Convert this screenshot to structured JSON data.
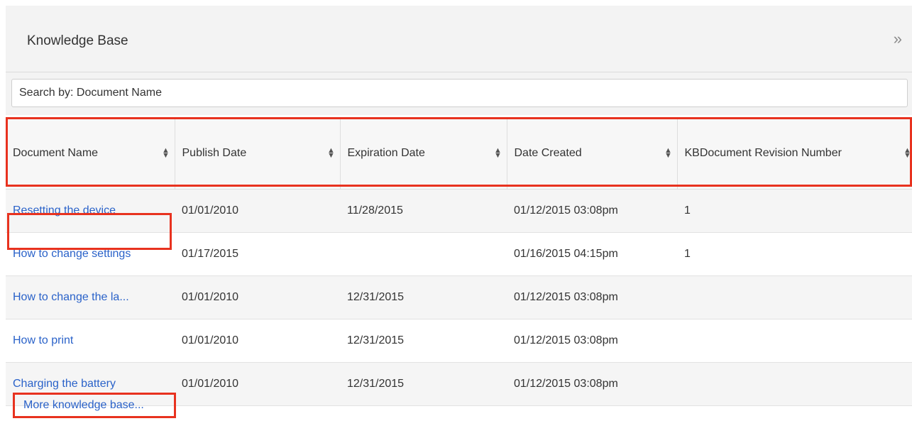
{
  "panel": {
    "title": "Knowledge Base",
    "collapse_icon": "»"
  },
  "search": {
    "placeholder": "Search by: Document Name"
  },
  "table": {
    "columns": [
      "Document Name",
      "Publish Date",
      "Expiration Date",
      "Date Created",
      "KBDocument Revision Number"
    ],
    "rows": [
      {
        "name": "Resetting the device",
        "publish": "01/01/2010",
        "expiration": "11/28/2015",
        "created": "01/12/2015 03:08pm",
        "revision": "1"
      },
      {
        "name": "How to change settings",
        "publish": "01/17/2015",
        "expiration": "",
        "created": "01/16/2015 04:15pm",
        "revision": "1"
      },
      {
        "name": "How to change the la...",
        "publish": "01/01/2010",
        "expiration": "12/31/2015",
        "created": "01/12/2015 03:08pm",
        "revision": ""
      },
      {
        "name": "How to print",
        "publish": "01/01/2010",
        "expiration": "12/31/2015",
        "created": "01/12/2015 03:08pm",
        "revision": ""
      },
      {
        "name": "Charging the battery",
        "publish": "01/01/2010",
        "expiration": "12/31/2015",
        "created": "01/12/2015 03:08pm",
        "revision": ""
      }
    ]
  },
  "footer": {
    "more_label": "More knowledge base..."
  },
  "colors": {
    "link": "#2a62c9",
    "highlight": "#e8321f",
    "header_bg": "#f3f3f3"
  }
}
